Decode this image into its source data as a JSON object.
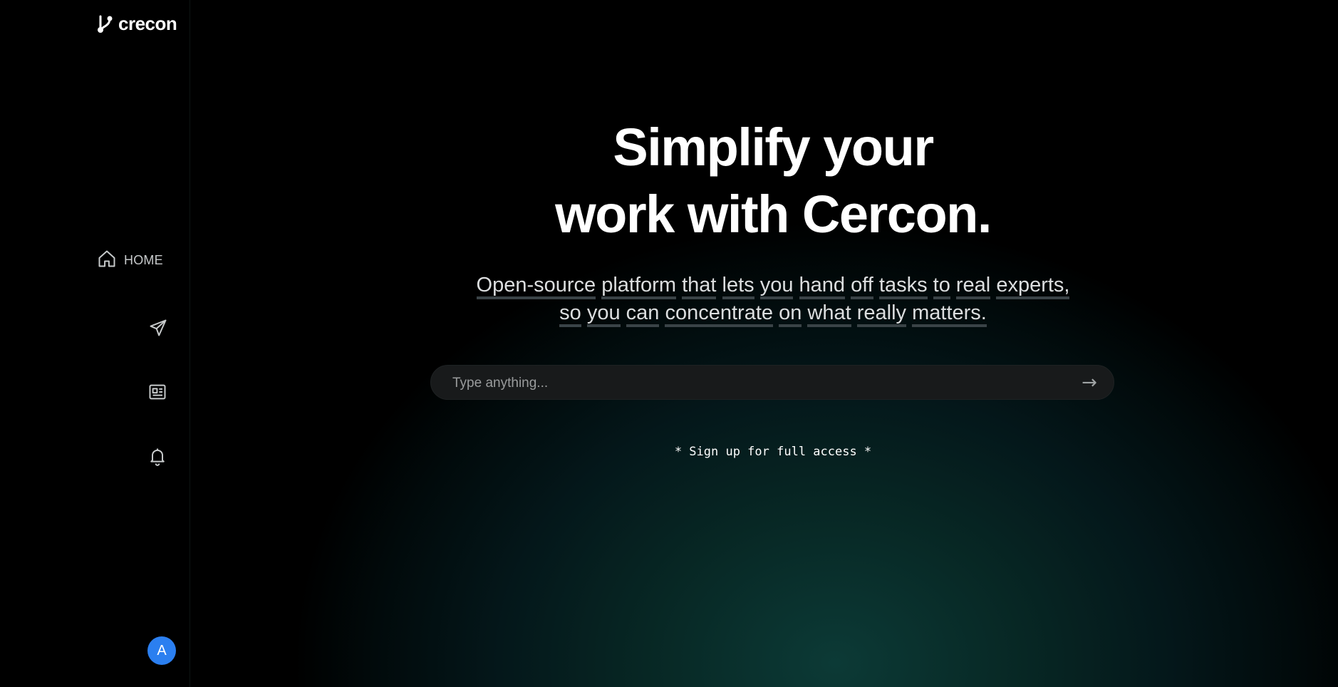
{
  "sidebar": {
    "logo_text": "crecon",
    "logo_icon": "branch-icon",
    "nav": {
      "home_label": "HOME",
      "home_icon": "home-icon",
      "icons": [
        "send-icon",
        "news-icon",
        "bell-icon"
      ]
    },
    "avatar_letter": "A",
    "avatar_color": "#2b7ff0"
  },
  "main": {
    "title_line1": "Simplify your",
    "title_line2": "work with Cercon.",
    "subtitle_words_line1": [
      "Open-source",
      "platform",
      "that",
      "lets",
      "you",
      "hand",
      "off",
      "tasks",
      "to",
      "real",
      "experts,"
    ],
    "subtitle_words_line2": [
      "so",
      "you",
      "can",
      "concentrate",
      "on",
      "what",
      "really",
      "matters."
    ],
    "search": {
      "placeholder": "Type anything...",
      "submit_glyph": "→"
    },
    "signup_note": "* Sign up for full access *"
  },
  "colors": {
    "background": "#000000",
    "glow": "#0c3a36",
    "accent_avatar": "#2b7ff0"
  }
}
